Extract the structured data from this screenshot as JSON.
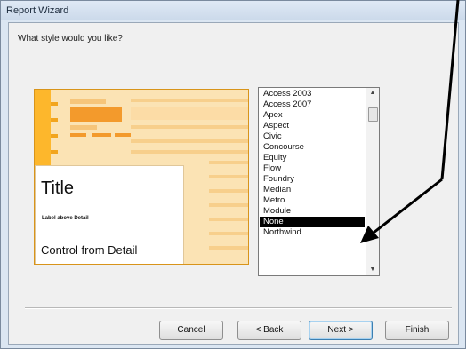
{
  "window": {
    "title": "Report Wizard"
  },
  "wizard": {
    "question": "What style would you like?",
    "preview": {
      "title": "Title",
      "label_text": "Label above Detail",
      "control_text": "Control from Detail"
    },
    "styles": [
      "Access 2003",
      "Access 2007",
      "Apex",
      "Aspect",
      "Civic",
      "Concourse",
      "Equity",
      "Flow",
      "Foundry",
      "Median",
      "Metro",
      "Module",
      "None",
      "Northwind"
    ],
    "selected_style": "None"
  },
  "buttons": {
    "cancel": "Cancel",
    "back": "< Back",
    "next": "Next >",
    "finish": "Finish"
  },
  "colors": {
    "preview_accent": "#fdb72c",
    "selection": "#000000",
    "annotation_arrow": "#000000"
  }
}
